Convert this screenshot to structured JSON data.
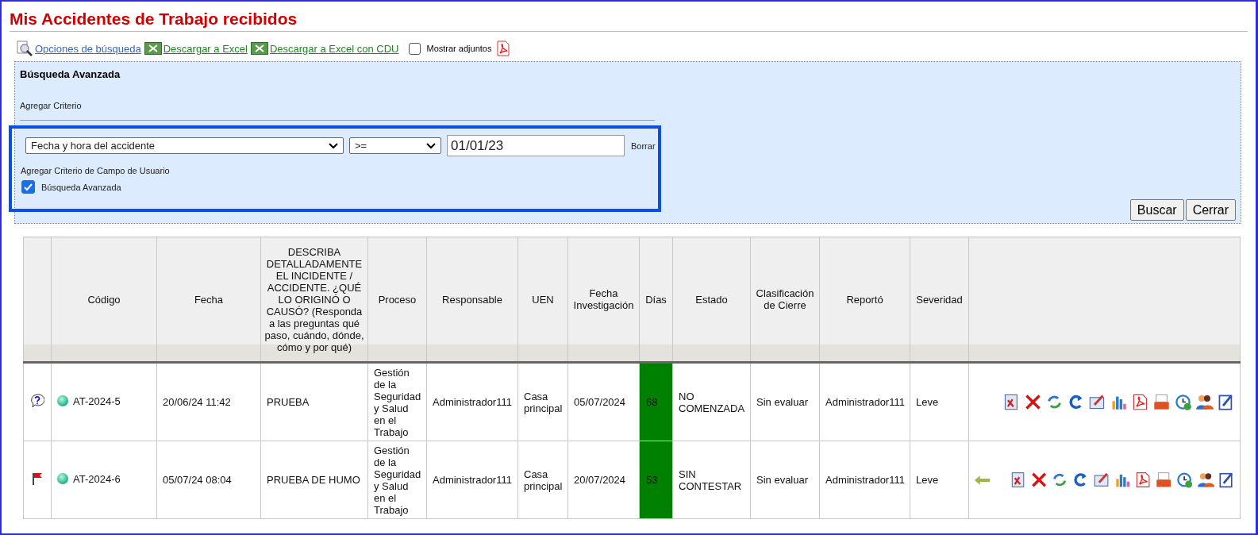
{
  "title": "Mis Accidentes de Trabajo recibidos",
  "toolbar": {
    "links": [
      {
        "label": "Opciones de búsqueda",
        "kind": "search"
      },
      {
        "label": "Descargar a Excel",
        "kind": "excel"
      },
      {
        "label": "Descargar a Excel con CDU",
        "kind": "excel"
      }
    ],
    "attachments": {
      "label": "Mostrar adjuntos",
      "checked": false
    }
  },
  "search": {
    "heading": "Búsqueda Avanzada",
    "add_criterion": "Agregar Criterio",
    "criterion": {
      "field": "Fecha y hora del accidente",
      "operator": ">=",
      "value": "01/01/23",
      "clear": "Borrar"
    },
    "add_user_field": "Agregar Criterio de Campo de Usuario",
    "advanced": {
      "label": "Búsqueda Avanzada",
      "checked": true
    },
    "buttons": [
      "Buscar",
      "Cerrar"
    ]
  },
  "table": {
    "columns": [
      "Código",
      "Fecha",
      "DESCRIBA DETALLADAMENTE EL INCIDENTE / ACCIDENTE. ¿QUÉ LO ORIGINÓ O CAUSÓ? (Responda a las preguntas qué paso, cuándo, dónde, cómo y por qué)",
      "Proceso",
      "Responsable",
      "UEN",
      "Fecha Investigación",
      "Días",
      "Estado",
      "Clasificación de Cierre",
      "Reportó",
      "Severidad"
    ],
    "rows": [
      {
        "kind": "question",
        "code": "AT-2024-5",
        "date": "20/06/24 11:42",
        "description": "PRUEBA",
        "process": "Gestión de la Seguridad y Salud en el Trabajo",
        "owner": "Administrador111",
        "uen": "Casa principal",
        "investigation_date": "05/07/2024",
        "days": "68",
        "color": "#008000",
        "status": "NO COMENZADA",
        "closure": "Sin evaluar",
        "reporter": "Administrador111",
        "severity": "Leve",
        "back_arrow": false
      },
      {
        "kind": "flag",
        "code": "AT-2024-6",
        "date": "05/07/24 08:04",
        "description": "PRUEBA DE HUMO",
        "process": "Gestión de la Seguridad y Salud en el Trabajo",
        "owner": "Administrador111",
        "uen": "Casa principal",
        "investigation_date": "20/07/2024",
        "days": "53",
        "color": "#008000",
        "status": "SIN CONTESTAR",
        "closure": "Sin evaluar",
        "reporter": "Administrador111",
        "severity": "Leve",
        "back_arrow": true
      }
    ]
  }
}
